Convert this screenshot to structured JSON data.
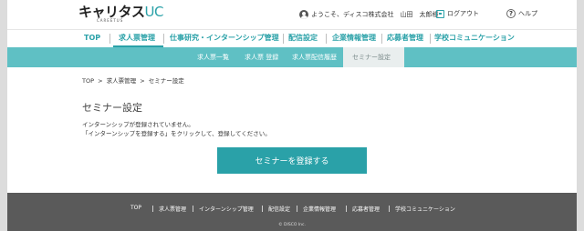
{
  "header": {
    "logo_main": "キャリタス",
    "logo_accent": "UC",
    "logo_sub": "CAREETUS",
    "user_text": "ようこそ、ディスコ株式会社　山田　太郎様",
    "logout_label": "ログアウト",
    "help_label": "ヘルプ",
    "help_icon_glyph": "?",
    "accent_color": "#2aa1a8"
  },
  "mainnav": {
    "items": [
      {
        "label": "TOP"
      },
      {
        "label": "求人票管理"
      },
      {
        "label": "仕事研究・インターンシップ管理"
      },
      {
        "label": "配信設定"
      },
      {
        "label": "企業情報管理"
      },
      {
        "label": "応募者管理"
      },
      {
        "label": "学校コミュニケーション"
      }
    ],
    "active": "求人票管理"
  },
  "subnav": {
    "items": [
      {
        "label": "求人票一覧"
      },
      {
        "label": "求人票 登録"
      },
      {
        "label": "求人票配信履歴"
      },
      {
        "label": "セミナー設定"
      }
    ],
    "active": "セミナー設定",
    "bg_color": "#5fc0c4"
  },
  "breadcrumb": {
    "items": [
      "TOP",
      "求人票管理",
      "セミナー設定"
    ],
    "separator": ">"
  },
  "main": {
    "title": "セミナー設定",
    "message_line1": "インターンシップが登録されていません。",
    "message_line2": "「インターンシップを登録する」をクリックして、登録してください。",
    "register_button": "セミナーを登録する"
  },
  "footer": {
    "links": [
      {
        "label": "TOP"
      },
      {
        "label": "求人票管理"
      },
      {
        "label": "インターンシップ管理"
      },
      {
        "label": "配信設定"
      },
      {
        "label": "企業情報管理"
      },
      {
        "label": "応募者管理"
      },
      {
        "label": "学校コミュニケーション"
      }
    ],
    "copyright": "© DISCO Inc.",
    "bg_color": "#5a5a5a"
  }
}
